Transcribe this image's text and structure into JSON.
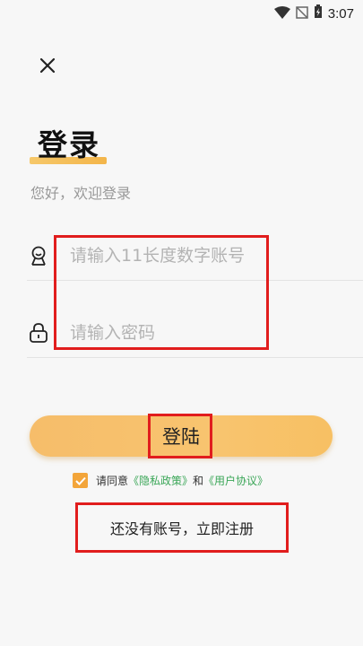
{
  "status_bar": {
    "time": "3:07",
    "icons": [
      "wifi-icon",
      "no-signal-icon",
      "battery-charging-icon"
    ]
  },
  "close_icon": "close-icon",
  "title": "登录",
  "subtitle": "您好，欢迎登录",
  "account": {
    "icon": "account-icon",
    "placeholder": "请输入11长度数字账号",
    "value": ""
  },
  "password": {
    "icon": "lock-icon",
    "placeholder": "请输入密码",
    "value": ""
  },
  "login_button": "登陆",
  "agreement": {
    "checked": true,
    "prefix": "请同意",
    "privacy": "《隐私政策》",
    "and": "和",
    "user_agreement": "《用户协议》"
  },
  "register_link": "还没有账号，立即注册",
  "colors": {
    "accent": "#F5B94F",
    "link": "#3AA657",
    "highlight_box": "#E11D1D"
  }
}
